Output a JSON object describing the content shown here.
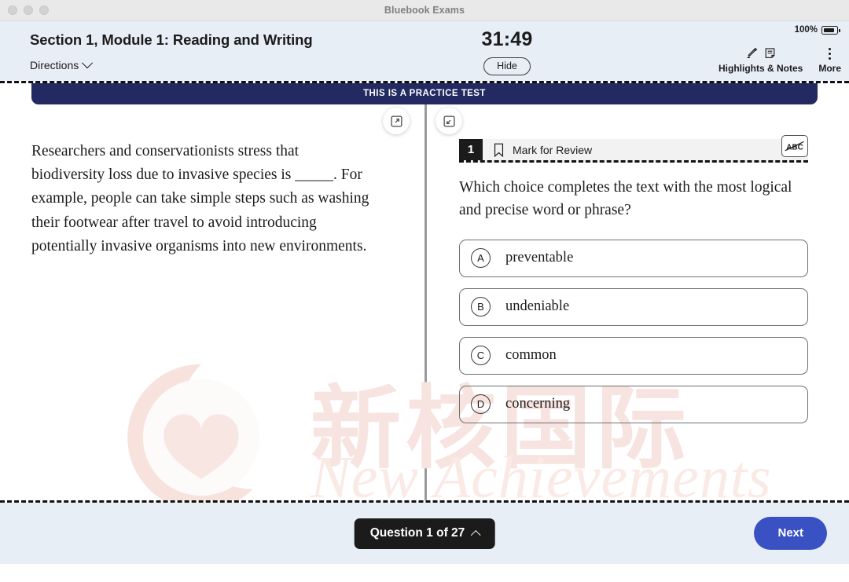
{
  "window": {
    "title": "Bluebook Exams",
    "traffic_lights": [
      "close",
      "minimize",
      "maximize"
    ]
  },
  "header": {
    "section_title": "Section 1, Module 1: Reading and Writing",
    "directions_label": "Directions",
    "timer": "31:49",
    "hide_label": "Hide",
    "battery_percent": "100%",
    "highlights_label": "Highlights & Notes",
    "more_label": "More"
  },
  "banner": {
    "text": "THIS IS A PRACTICE TEST"
  },
  "passage": {
    "text": "Researchers and conservationists stress that biodiversity loss due to invasive species is _____. For example, people can take simple steps such as washing their footwear after travel to avoid introducing potentially invasive organisms into new environments."
  },
  "question": {
    "number": "1",
    "mark_for_review_label": "Mark for Review",
    "prompt": "Which choice completes the text with the most logical and precise word or phrase?",
    "choices": [
      {
        "letter": "A",
        "text": "preventable"
      },
      {
        "letter": "B",
        "text": "undeniable"
      },
      {
        "letter": "C",
        "text": "common"
      },
      {
        "letter": "D",
        "text": "concerning"
      }
    ]
  },
  "footer": {
    "question_nav": "Question 1 of 27",
    "next_label": "Next"
  },
  "watermark": {
    "chinese": "新核国际",
    "english": "New Achievements"
  },
  "colors": {
    "header_bg": "#e8eef6",
    "banner_navy": "#232a62",
    "next_blue": "#3a51c4",
    "badge_black": "#1b1b1b",
    "watermark_pink": "#f7e3df"
  }
}
